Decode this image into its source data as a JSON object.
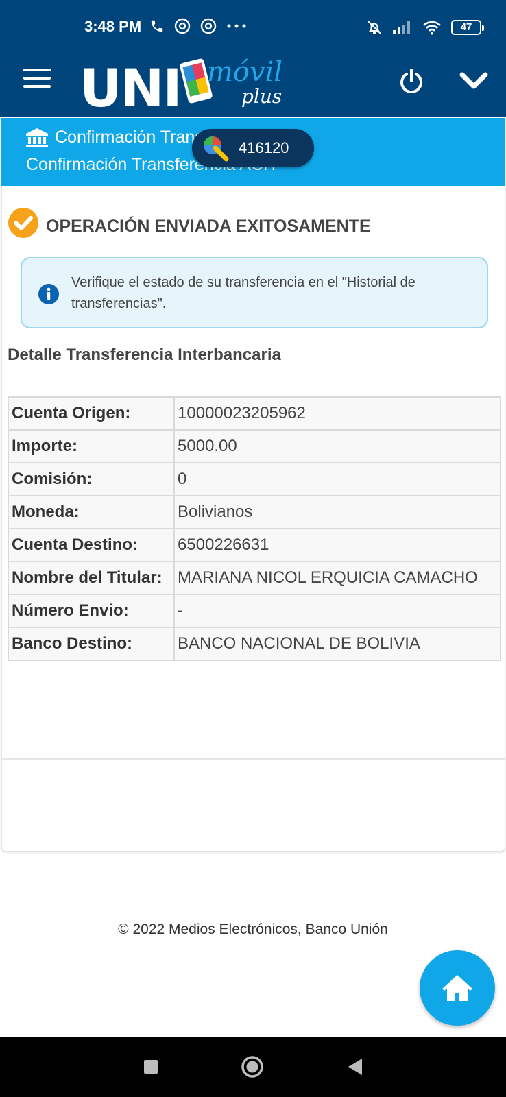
{
  "status_bar": {
    "time": "3:48 PM",
    "battery": "47"
  },
  "header": {
    "logo_text": "UNI",
    "logo_sub1": "móvil",
    "logo_sub2": "plus"
  },
  "banner": {
    "line1": "Confirmación Transferencia ACH",
    "line2": "Confirmación Transferencia ACH"
  },
  "otp_overlay": {
    "code": "416120"
  },
  "content": {
    "success_title": "OPERACIÓN ENVIADA EXITOSAMENTE",
    "alert_text": "Verifique el estado de su transferencia en el \"Historial de transferencias\".",
    "detail_heading": "Detalle Transferencia Interbancaria",
    "rows": [
      {
        "label": "Cuenta Origen:",
        "value": "10000023205962"
      },
      {
        "label": "Importe:",
        "value": "5000.00"
      },
      {
        "label": "Comisión:",
        "value": "0"
      },
      {
        "label": "Moneda:",
        "value": "Bolivianos"
      },
      {
        "label": "Cuenta Destino:",
        "value": "6500226631"
      },
      {
        "label": "Nombre del Titular:",
        "value": "MARIANA NICOL ERQUICIA CAMACHO"
      },
      {
        "label": "Número Envio:",
        "value": "-"
      },
      {
        "label": "Banco Destino:",
        "value": "BANCO NACIONAL DE BOLIVIA"
      }
    ]
  },
  "footer": {
    "copyright": "© 2022 Medios Electrónicos, Banco Unión"
  },
  "colors": {
    "header_bg": "#00447c",
    "banner_bg": "#0fa7e8",
    "success_orange": "#f7a21b",
    "info_blue": "#0b62b0"
  }
}
